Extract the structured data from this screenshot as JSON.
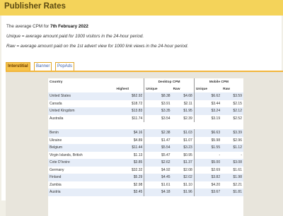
{
  "page_title": "Publisher Rates",
  "intro": {
    "line1_prefix": "The average CPM for",
    "line1_date": "7th February 2022",
    "line2": "Unique = average amount paid for 1000 visitors in the 24-hour period.",
    "line3": "Raw = average amount paid on the 1st advert view for 1000 link views in the 24-hour period."
  },
  "tabs": [
    "Interstitial",
    "Banner",
    "PopAds"
  ],
  "table": {
    "group_desktop": "Desktop CPM",
    "group_mobile": "Mobile CPM",
    "col_country": "Country",
    "col_highest": "Highest",
    "col_unique": "Unique",
    "col_raw": "Raw",
    "group1": [
      {
        "country": "United States",
        "highest": "$62.92",
        "d_unique": "$8.38",
        "d_raw": "$4.68",
        "m_unique": "$6.62",
        "m_raw": "$3.59"
      },
      {
        "country": "Canada",
        "highest": "$18.72",
        "d_unique": "$3.91",
        "d_raw": "$2.11",
        "m_unique": "$3.44",
        "m_raw": "$2.15"
      },
      {
        "country": "United Kingdom",
        "highest": "$13.83",
        "d_unique": "$3.35",
        "d_raw": "$1.95",
        "m_unique": "$3.24",
        "m_raw": "$2.12"
      },
      {
        "country": "Australia",
        "highest": "$11.74",
        "d_unique": "$3.54",
        "d_raw": "$2.39",
        "m_unique": "$3.19",
        "m_raw": "$2.52"
      }
    ],
    "group2": [
      {
        "country": "Benin",
        "highest": "$4.16",
        "d_unique": "$2.38",
        "d_raw": "$1.03",
        "m_unique": "$6.63",
        "m_raw": "$3.39"
      },
      {
        "country": "Ukraine",
        "highest": "$4.89",
        "d_unique": "$1.47",
        "d_raw": "$1.07",
        "m_unique": "$5.98",
        "m_raw": "$2.96"
      },
      {
        "country": "Belgium",
        "highest": "$11.44",
        "d_unique": "$5.54",
        "d_raw": "$3.23",
        "m_unique": "$1.55",
        "m_raw": "$1.12"
      },
      {
        "country": "Virgin Islands, British",
        "highest": "$1.13",
        "d_unique": "$5.47",
        "d_raw": "$0.95",
        "m_unique": "-",
        "m_raw": "-"
      },
      {
        "country": "Cote D'Ivoire",
        "highest": "$3.85",
        "d_unique": "$2.62",
        "d_raw": "$1.37",
        "m_unique": "$5.00",
        "m_raw": "$3.08"
      },
      {
        "country": "Germany",
        "highest": "$32.32",
        "d_unique": "$4.92",
        "d_raw": "$2.08",
        "m_unique": "$2.69",
        "m_raw": "$1.61"
      },
      {
        "country": "Finland",
        "highest": "$5.29",
        "d_unique": "$4.45",
        "d_raw": "$2.02",
        "m_unique": "$3.82",
        "m_raw": "$1.98"
      },
      {
        "country": "Zambia",
        "highest": "$2.98",
        "d_unique": "$1.61",
        "d_raw": "$1.10",
        "m_unique": "$4.20",
        "m_raw": "$2.21"
      },
      {
        "country": "Austria",
        "highest": "$3.45",
        "d_unique": "$4.18",
        "d_raw": "$1.96",
        "m_unique": "$3.67",
        "m_raw": "$1.81"
      }
    ]
  },
  "colors": {
    "title_bar": "#f4d35a",
    "tab_active": "#f7c44c",
    "row_alt": "#e6edf8"
  }
}
